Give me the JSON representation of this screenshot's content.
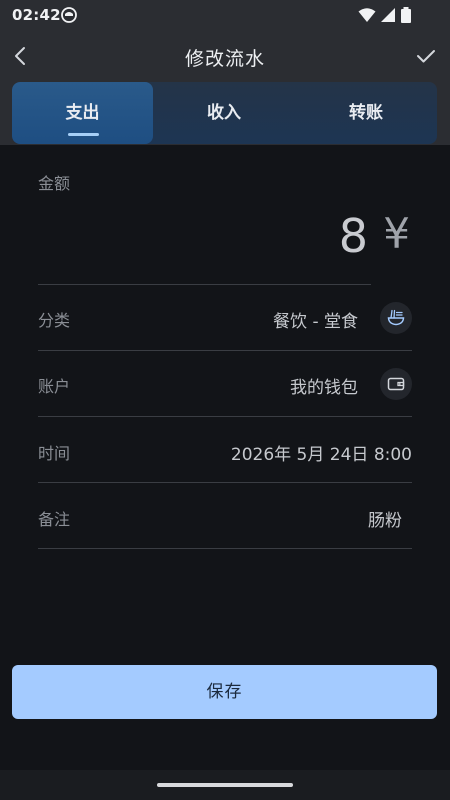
{
  "status_bar": {
    "time": "02:42"
  },
  "header": {
    "title": "修改流水"
  },
  "tabs": [
    {
      "label": "支出",
      "active": true
    },
    {
      "label": "收入",
      "active": false
    },
    {
      "label": "转账",
      "active": false
    }
  ],
  "form": {
    "amount": {
      "label": "金额",
      "value": "8",
      "currency": "¥"
    },
    "category": {
      "label": "分类",
      "value": "餐饮 - 堂食",
      "icon": "noodle-bowl-icon"
    },
    "account": {
      "label": "账户",
      "value": "我的钱包",
      "icon": "wallet-icon"
    },
    "time": {
      "label": "时间",
      "value": "2026年 5月 24日 8:00"
    },
    "note": {
      "label": "备注",
      "value": "肠粉"
    }
  },
  "actions": {
    "save_label": "保存"
  },
  "colors": {
    "accent": "#a4cbff",
    "tab_active": "#1e4e82",
    "background": "#121418"
  }
}
